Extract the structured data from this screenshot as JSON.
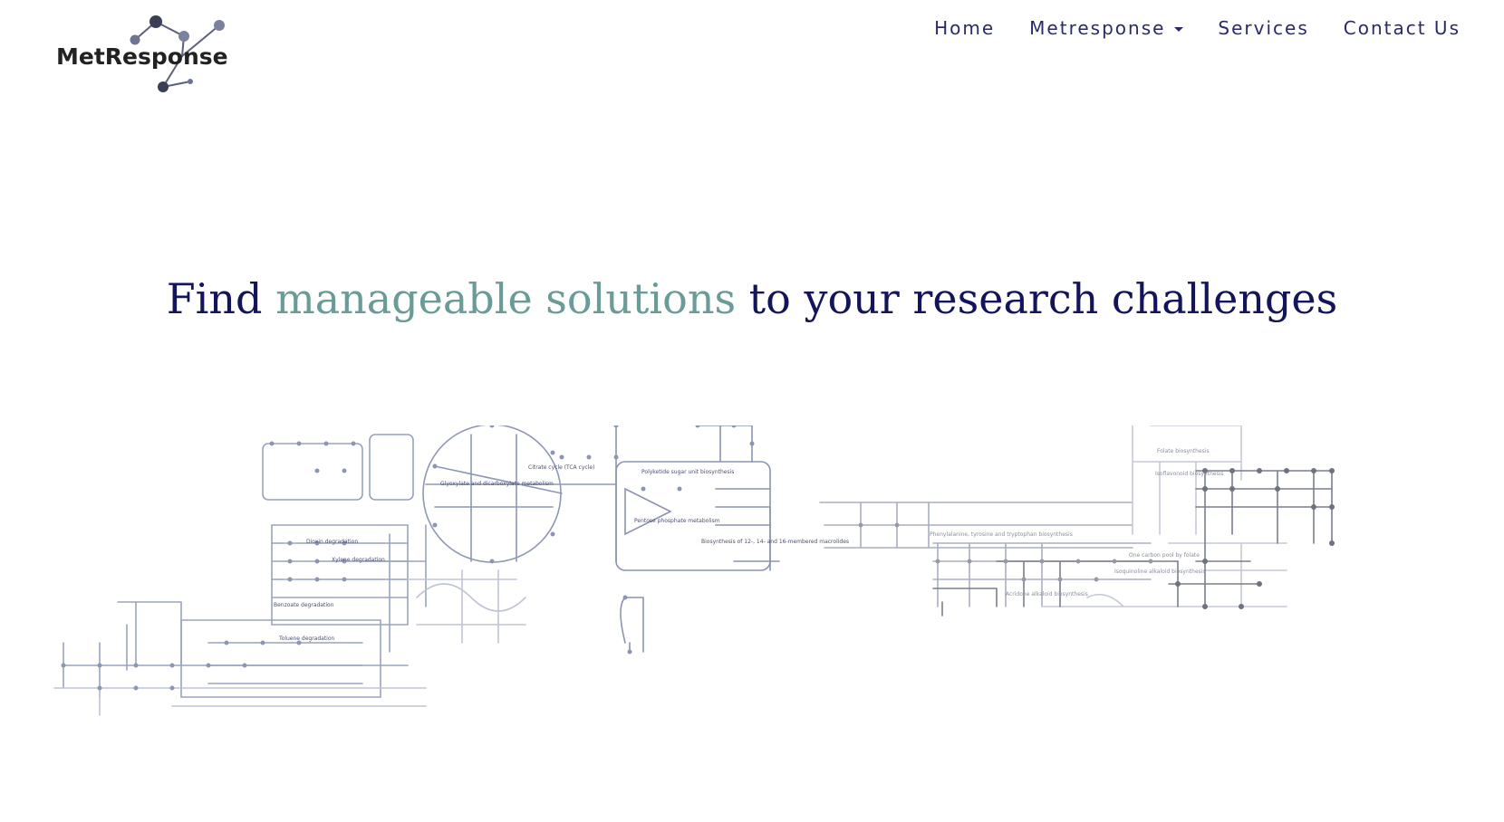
{
  "logo": {
    "text": "MetResponse",
    "icon": "molecule-network-icon"
  },
  "nav": {
    "items": [
      {
        "label": "Home"
      },
      {
        "label": "Metresponse",
        "has_dropdown": true
      },
      {
        "label": "Services"
      },
      {
        "label": "Contact Us"
      }
    ]
  },
  "hero": {
    "headline_part1": "Find ",
    "headline_accent": "manageable solutions",
    "headline_part2": " to your research challenges"
  },
  "pathway_map": {
    "labels": [
      "Glyoxylate and dicarboxylate metabolism",
      "Citrate cycle (TCA cycle)",
      "Polyketide sugar unit biosynthesis",
      "Pentose phosphate metabolism",
      "Biosynthesis of 12-, 14- and 16-membered macrolides",
      "Dioxin degradation",
      "Xylene degradation",
      "Benzoate degradation",
      "Toluene degradation",
      "Phenylalanine, tyrosine and tryptophan biosynthesis",
      "Folate biosynthesis",
      "Isoflavonoid biosynthesis",
      "One carbon pool by folate",
      "Isoquinoline alkaloid biosynthesis",
      "Acridone alkaloid biosynthesis"
    ]
  },
  "colors": {
    "nav_text": "#2a2a6a",
    "headline_text": "#13145a",
    "headline_accent": "#6a9b97",
    "logo_text": "#222222"
  }
}
